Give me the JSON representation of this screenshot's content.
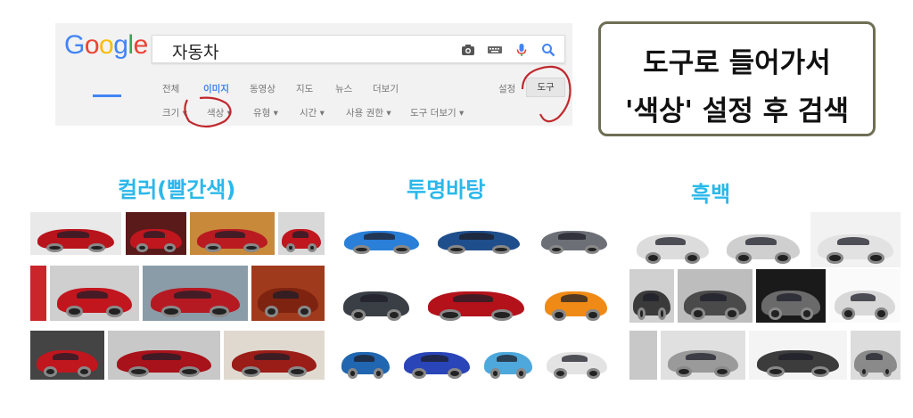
{
  "google": {
    "logo": [
      "G",
      "o",
      "o",
      "g",
      "l",
      "e"
    ],
    "logo_colors": [
      "#4285f4",
      "#ea4335",
      "#fbbc05",
      "#4285f4",
      "#34a853",
      "#ea4335"
    ],
    "query": "자동차",
    "search_icons": [
      "camera-icon",
      "keyboard-icon",
      "microphone-icon",
      "search-icon"
    ],
    "tabs": [
      "전체",
      "이미지",
      "동영상",
      "지도",
      "뉴스",
      "더보기"
    ],
    "active_tab": "이미지",
    "settings_label": "설정",
    "tools_label": "도구",
    "filters": [
      "크기 ▾",
      "색상 ▾",
      "유형 ▾",
      "시간 ▾",
      "사용 권한 ▾",
      "도구 더보기 ▾"
    ]
  },
  "callout": {
    "line1": "도구로 들어가서",
    "line2": "'색상' 설정 후 검색"
  },
  "sections": {
    "color": "컬러(빨간색)",
    "transparent": "투명바탕",
    "bw": "흑백"
  },
  "colors": {
    "google_blue": "#4285f4",
    "section_title": "#2bb8ea",
    "annotation_red": "#c0282d",
    "callout_border": "#6e6e55"
  }
}
